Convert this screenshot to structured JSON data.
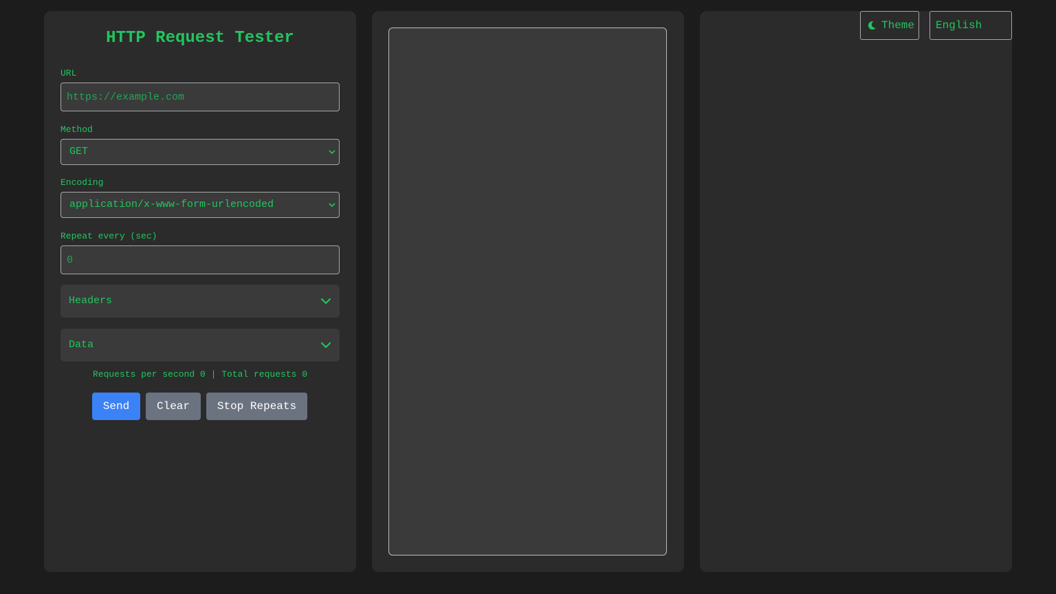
{
  "app": {
    "title": "HTTP Request Tester"
  },
  "form": {
    "url": {
      "label": "URL",
      "placeholder": "https://example.com",
      "value": ""
    },
    "method": {
      "label": "Method",
      "value": "GET"
    },
    "encoding": {
      "label": "Encoding",
      "value": "application/x-www-form-urlencoded"
    },
    "repeat": {
      "label": "Repeat every (sec)",
      "placeholder": "0",
      "value": ""
    },
    "headers_label": "Headers",
    "data_label": "Data"
  },
  "stats": {
    "text": "Requests per second 0 | Total requests 0"
  },
  "buttons": {
    "send": "Send",
    "clear": "Clear",
    "stop": "Stop Repeats"
  },
  "topbar": {
    "theme_label": "Theme",
    "language": "English"
  },
  "colors": {
    "accent_text": "#22c55e",
    "primary_button": "#3b82f6",
    "secondary_button": "#6b7280",
    "background": "#1c1c1c",
    "panel": "#2b2b2b"
  },
  "icons": {
    "theme": "moon-icon",
    "select_arrow": "chevron-down-icon",
    "accordion_arrow": "chevron-down-icon"
  }
}
